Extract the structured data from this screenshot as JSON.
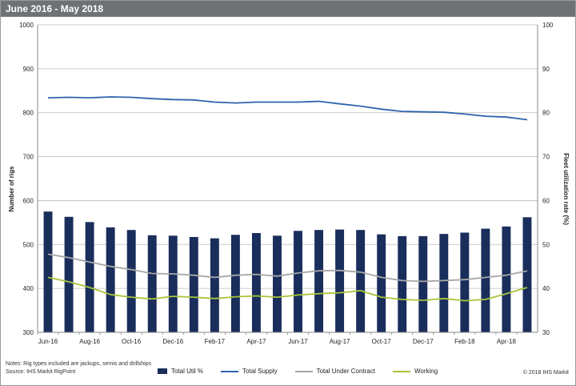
{
  "header": {
    "title": "June 2016 - May 2018"
  },
  "chart_data": {
    "type": "bar",
    "categories": [
      "Jun-16",
      "Jul-16",
      "Aug-16",
      "Sep-16",
      "Oct-16",
      "Nov-16",
      "Dec-16",
      "Jan-17",
      "Feb-17",
      "Mar-17",
      "Apr-17",
      "May-17",
      "Jun-17",
      "Jul-17",
      "Aug-17",
      "Sep-17",
      "Oct-17",
      "Nov-17",
      "Dec-17",
      "Jan-18",
      "Feb-18",
      "Mar-18",
      "Apr-18",
      "May-18"
    ],
    "tick_labels": [
      "Jun-16",
      "Aug-16",
      "Oct-16",
      "Dec-16",
      "Feb-17",
      "Apr-17",
      "Jun-17",
      "Aug-17",
      "Oct-17",
      "Dec-17",
      "Feb-18",
      "Apr-18"
    ],
    "ylabel": "Number of rigs",
    "y2label": "Fleet utilization rate (%)",
    "ylim": [
      300,
      1000
    ],
    "y2lim": [
      30,
      100
    ],
    "yticks": [
      "300",
      "400",
      "500",
      "600",
      "700",
      "800",
      "900",
      "1000"
    ],
    "y2ticks": [
      "30",
      "40",
      "50",
      "60",
      "70",
      "80",
      "90",
      "100"
    ],
    "grid": true,
    "legend_position": "bottom",
    "series": [
      {
        "name": "Total Util %",
        "type": "bar",
        "axis": "right",
        "color": "#1a2e5c",
        "values": [
          57.5,
          56.3,
          55.1,
          53.9,
          53.3,
          52.1,
          52.0,
          51.7,
          51.4,
          52.2,
          52.6,
          52.0,
          53.1,
          53.3,
          53.4,
          53.3,
          52.3,
          51.9,
          51.9,
          52.4,
          52.7,
          53.6,
          54.1,
          56.2
        ]
      },
      {
        "name": "Total Supply",
        "type": "line",
        "axis": "left",
        "color": "#2e63ad",
        "values": [
          834,
          835,
          834,
          836,
          835,
          832,
          830,
          829,
          824,
          822,
          824,
          824,
          824,
          826,
          820,
          815,
          808,
          803,
          802,
          801,
          797,
          792,
          790,
          784
        ]
      },
      {
        "name": "Total Under Contract",
        "type": "line",
        "axis": "left",
        "color": "#a6a6a6",
        "values": [
          478,
          470,
          460,
          450,
          443,
          434,
          433,
          430,
          425,
          430,
          432,
          428,
          435,
          440,
          441,
          437,
          425,
          418,
          416,
          418,
          420,
          425,
          430,
          440
        ]
      },
      {
        "name": "Working",
        "type": "line",
        "axis": "left",
        "color": "#a8c43a",
        "values": [
          425,
          415,
          402,
          386,
          380,
          376,
          382,
          380,
          377,
          381,
          383,
          380,
          385,
          388,
          390,
          395,
          380,
          375,
          373,
          377,
          372,
          375,
          388,
          402
        ]
      }
    ]
  },
  "notes": {
    "line1": "Notes: Rig types included are jackups, semis and drillships",
    "line2": "Source: IHS Markit RigPoint"
  },
  "copyright": "© 2018 IHS Markit"
}
